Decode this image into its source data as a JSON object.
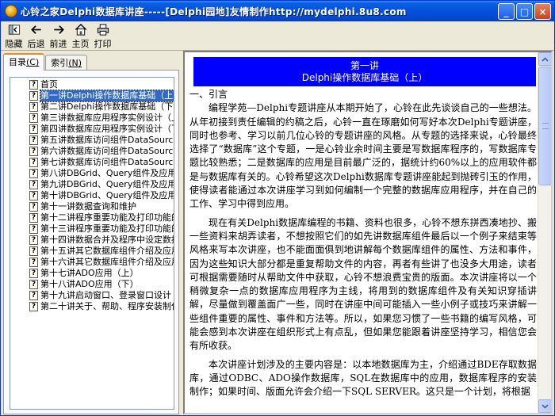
{
  "window": {
    "title": "心铃之家Delphi数据库讲座-----[Delphi园地]友情制作http://mydelphi.8u8.com",
    "controls": {
      "minimize": "_",
      "maximize": "□",
      "close": "×"
    }
  },
  "toolbar": {
    "buttons": [
      {
        "label": "隐藏",
        "icon": "hide-icon"
      },
      {
        "label": "后退",
        "icon": "back-arrow-icon"
      },
      {
        "label": "前进",
        "icon": "forward-arrow-icon"
      },
      {
        "label": "主页",
        "icon": "home-icon"
      },
      {
        "label": "打印",
        "icon": "printer-icon"
      }
    ]
  },
  "left": {
    "tabs": [
      {
        "label": "目录",
        "hotkey": "(C)"
      },
      {
        "label": "索引",
        "hotkey": "(N)"
      }
    ],
    "tree": [
      "首页",
      "第一讲Delphi操作数据库基础（上）",
      "第二讲Delphi操作数据库基础（下）",
      "第三讲数据库应用程序实例设计（上）",
      "第四讲数据库应用程序实例设计（下）",
      "第五讲数据库访问组件DataSource",
      "第六讲数据库访问组件DataSource",
      "第七讲数据库访问组件DataSource",
      "第八讲DBGrid、Query组件及应用（",
      "第九讲DBGrid、Query组件及应用（",
      "第十讲DBGrid、Query组件及应用（",
      "第十一讲数据查询和维护",
      "第十二讲程序重要功能及打印功能的",
      "第十三讲程序重要功能及打印功能的",
      "第十四讲数据合并及程序中设定数据",
      "第十五讲其它数据库组件介绍及应用",
      "第十六讲其它数据库组件介绍及应用",
      "第十七讲ADO应用（上）",
      "第十八讲ADO应用（下）",
      "第十九讲启动窗口、登录窗口设计",
      "第二十讲关于、帮助、程序安装制作"
    ],
    "selected_index": 1
  },
  "content": {
    "heading_line1": "第一讲",
    "heading_line2": "Delphi操作数据库基础（上）",
    "section": "一、引言",
    "paragraphs": [
      "编程学苑—Delphi专题讲座从本期开始了，心铃在此先谈谈自己的一些想法。从年初接到责任编辑的约稿之后，心铃一直在琢磨如何写好本次Delphi专题讲座，同时也参考、学习以前几位心铃的专题讲座的风格。从专题的选择来说，心铃最终选择了“数据库”这个专题，一是心铃业余时间主要是写数据库程序的，写数据库专题比较熟悉；二是数据库的应用是目前最广泛的，据统计约60%以上的应用软件都是与数据库有关的。心铃希望这次Delphi数据库专题讲座能起到抛砖引玉的作用，使得读者能通过本次讲座学习到如何编制一个完整的数据库应用程序，并在自己的工作、学习中得到应用。",
      "现在有关Delphi数据库编程的书籍、资料也很多，心铃不想东拼西凑地抄、搬一些资料来胡弄读者，不想按照它们的如先讲数据库组件最后以一个例子来结束等风格来写本次讲座，也不能面面俱到地讲解每个数据库组件的属性、方法和事件，因为这些知识大部分都是重复帮助文件的内容，再者有些讲了也没多大用途，读者可根据需要随时从帮助文件中获取，心铃不想浪费宝贵的版面。本次讲座将以一个稍微复杂一点的数据库应用程序为主线，将用到的数据库组件及有关知识穿插讲解，尽量做到覆盖面广一些，同时在讲座中间可能插入一些小例子或技巧来讲解一些组件重要的属性、事件和方法等。所以，如果您习惯了一些书籍的编写风格，可能会感到本次讲座在组织形式上有点乱，但如果您能跟着讲座坚持学习，相信您会有所收获。",
      "本次讲座计划涉及的主要内容是：以本地数据库为主，介绍通过BDE存取数据库，通过ODBC、ADO操作数据库，SQL在数据库中的应用，数据库程序的安装制作；如果时间、版面允许会介绍一下SQL SERVER。这只是一个计划，将根据"
    ]
  }
}
